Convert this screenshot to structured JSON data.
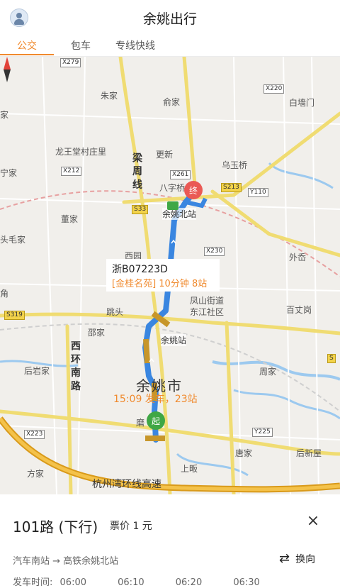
{
  "header": {
    "title": "余姚出行"
  },
  "tabs": [
    {
      "label": "公交"
    },
    {
      "label": "包车"
    },
    {
      "label": "专线快线"
    }
  ],
  "map": {
    "labels": {
      "zhujia": "朱家",
      "yujia": "俞家",
      "baiqiangmen": "白墙门",
      "jia_left": "家",
      "longwangtang": "龙王堂村庄里",
      "gengxin": "更新",
      "wuyuqiao": "乌玉桥",
      "ningjia": "宁家",
      "baziqiao": "八字桥",
      "dongjia": "董家",
      "toumaojia": "头毛家",
      "waidou": "外岙",
      "xiyuan": "西园",
      "jiao": "角",
      "tiaotou": "跳头",
      "fengshan": "凤山街道",
      "dongjiang": "东江社区",
      "baizhanggang": "百丈岗",
      "shaojia": "邵家",
      "houyanjia": "后岩家",
      "zhoujia": "周家",
      "yuyaoshi": "余姚市",
      "mocun": "磨 村",
      "tangjia": "唐家",
      "houxinwu": "后新屋",
      "fangjia": "方家",
      "shangshu": "上畈",
      "lianghou": "梁\n周\n线",
      "xihuan": "西\n环\n南\n路",
      "highway": "杭州湾环线高速"
    },
    "shields": {
      "x279": "X279",
      "x220": "X220",
      "x212": "X212",
      "x261": "X261",
      "s213": "S213",
      "y110": "Y110",
      "s33": "S33",
      "x230": "X230",
      "s319": "S319",
      "x223": "X223",
      "y225": "Y225",
      "s": "S"
    },
    "bus_plate": "浙B07223D",
    "bus_info": "[金桂名苑] 10分钟 8站",
    "departure_info": "15:09 发车，23站",
    "start_marker": "起",
    "end_marker": "终",
    "start_station": "余姚北站",
    "yuyao_station": "余姚站",
    "route_color": "#3a86e0",
    "accent_color": "#f08a2e"
  },
  "panel": {
    "route_name": "101路 (下行)",
    "fare": "票价 1 元",
    "close_icon": "×",
    "stations": "汽车南站 → 高铁余姚北站",
    "reverse_label": "换向",
    "times_label": "发车时间:",
    "times": [
      "06:00",
      "06:10",
      "06:20",
      "06:30"
    ]
  }
}
